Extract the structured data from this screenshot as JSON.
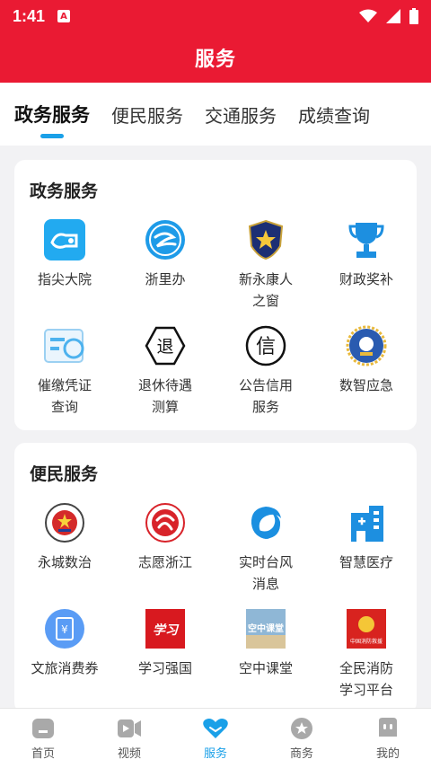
{
  "status": {
    "time": "1:41",
    "a_glyph": "A"
  },
  "header": {
    "title": "服务"
  },
  "tabs": [
    {
      "label": "政务服务"
    },
    {
      "label": "便民服务"
    },
    {
      "label": "交通服务"
    },
    {
      "label": "成绩查询"
    }
  ],
  "sections": [
    {
      "title": "政务服务",
      "items": [
        {
          "label": "指尖大院",
          "icon": "fingertip-icon"
        },
        {
          "label": "浙里办",
          "icon": "zheliban-icon"
        },
        {
          "label": "新永康人\n之窗",
          "icon": "police-badge-icon"
        },
        {
          "label": "财政奖补",
          "icon": "trophy-icon"
        },
        {
          "label": "催缴凭证\n查询",
          "icon": "card-icon"
        },
        {
          "label": "退休待遇\n测算",
          "icon": "retire-icon",
          "glyph": "退"
        },
        {
          "label": "公告信用\n服务",
          "icon": "credit-icon",
          "glyph": "信"
        },
        {
          "label": "数智应急",
          "icon": "emergency-emblem-icon"
        }
      ]
    },
    {
      "title": "便民服务",
      "items": [
        {
          "label": "永城数治",
          "icon": "city-emblem-icon"
        },
        {
          "label": "志愿浙江",
          "icon": "volunteer-icon"
        },
        {
          "label": "实时台风\n消息",
          "icon": "typhoon-icon"
        },
        {
          "label": "智慧医疗",
          "icon": "hospital-icon"
        },
        {
          "label": "文旅消费券",
          "icon": "coupon-icon",
          "glyph": "¥"
        },
        {
          "label": "学习强国",
          "icon": "xuexi-icon",
          "glyph": "学习"
        },
        {
          "label": "空中课堂",
          "icon": "air-classroom-icon",
          "glyph": "空中课堂"
        },
        {
          "label": "全民消防\n学习平台",
          "icon": "fire-learning-icon",
          "glyph": "中国消防救援"
        }
      ]
    }
  ],
  "bottom_nav": [
    {
      "label": "首页",
      "icon": "home-icon"
    },
    {
      "label": "视频",
      "icon": "video-icon"
    },
    {
      "label": "服务",
      "icon": "service-heart-icon"
    },
    {
      "label": "商务",
      "icon": "business-star-icon"
    },
    {
      "label": "我的",
      "icon": "profile-icon"
    }
  ],
  "colors": {
    "brand_red": "#ea1a33",
    "accent_blue": "#1aa0e8"
  }
}
